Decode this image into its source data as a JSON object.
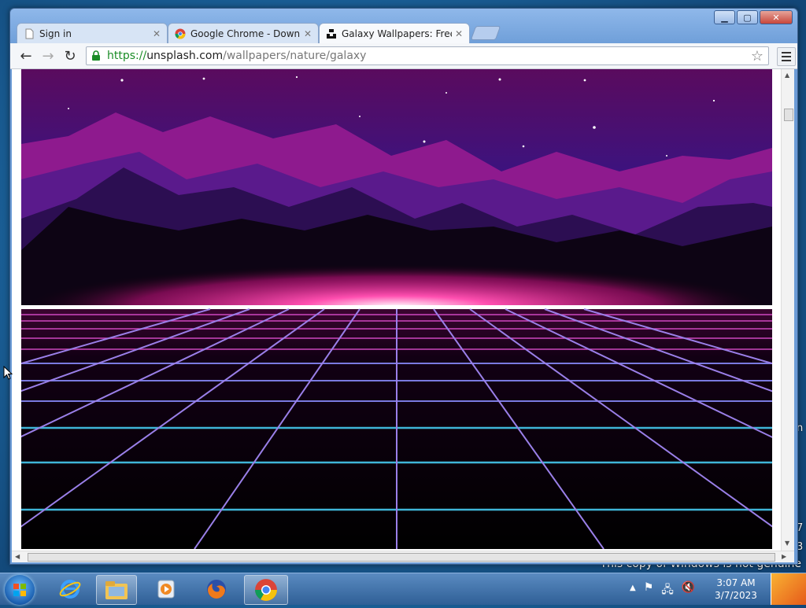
{
  "desktop": {
    "watermark": "This copy of Windows is not genuine",
    "fragment_1": "n",
    "fragment_2": "7",
    "fragment_3": "3"
  },
  "browser": {
    "tabs": [
      {
        "title": "Sign in",
        "active": false
      },
      {
        "title": "Google Chrome - Downloa",
        "active": false
      },
      {
        "title": "Galaxy Wallpapers: Free HD",
        "active": true
      }
    ],
    "address": {
      "scheme": "https://",
      "host": "unsplash.com",
      "path": "/wallpapers/nature/galaxy"
    },
    "accent_color": "#1a8c26"
  },
  "taskbar": {
    "apps": [
      "internet-explorer-icon",
      "file-explorer-icon",
      "media-player-icon",
      "firefox-icon",
      "chrome-icon"
    ],
    "clock_time": "3:07 AM",
    "clock_date": "3/7/2023"
  }
}
